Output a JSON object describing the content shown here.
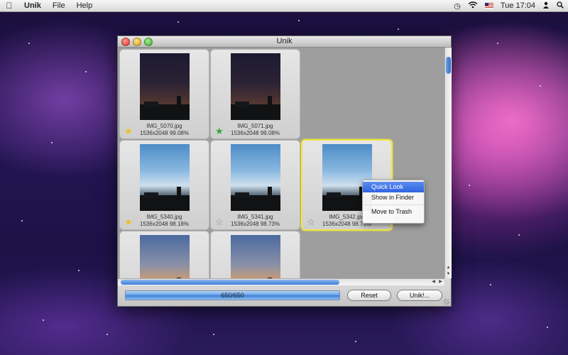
{
  "menubar": {
    "apple_icon": "apple-icon",
    "items": [
      "Unik",
      "File",
      "Help"
    ],
    "status": {
      "time_machine_icon": "clock-icon",
      "wifi_icon": "wifi-icon",
      "flag_icon": "us-flag-icon",
      "clock": "Tue 17:04",
      "user_icon": "user-icon",
      "spotlight_icon": "search-icon"
    }
  },
  "window": {
    "title": "Unik",
    "photos": [
      {
        "filename": "IMG_5070.jpg",
        "info": "1536x2048  99.08%",
        "star": "yellow"
      },
      {
        "filename": "IMG_5071.jpg",
        "info": "1536x2048  99.08%",
        "star": "green"
      },
      {
        "filename": "IMG_5340.jpg",
        "info": "1536x2048  98.18%",
        "star": "yellow"
      },
      {
        "filename": "IMG_5341.jpg",
        "info": "1536x2048  98.73%",
        "star": "empty"
      },
      {
        "filename": "IMG_5342.jpg",
        "info": "1536x2048  98.73%",
        "star": "empty",
        "selected": true
      },
      {
        "filename": "",
        "info": "",
        "star": ""
      },
      {
        "filename": "",
        "info": "",
        "star": ""
      }
    ],
    "progress": {
      "label": "650/650",
      "fraction": 1.0
    },
    "buttons": {
      "reset": "Reset",
      "unik": "Unik!..."
    }
  },
  "context_menu": {
    "items": [
      "Quick Look",
      "Show in Finder",
      "Move to Trash"
    ],
    "highlighted": "Quick Look"
  },
  "colors": {
    "selection_border": "#f0e640",
    "menu_highlight": "#2e64e0",
    "progress_fill": "#3c7cd8"
  }
}
